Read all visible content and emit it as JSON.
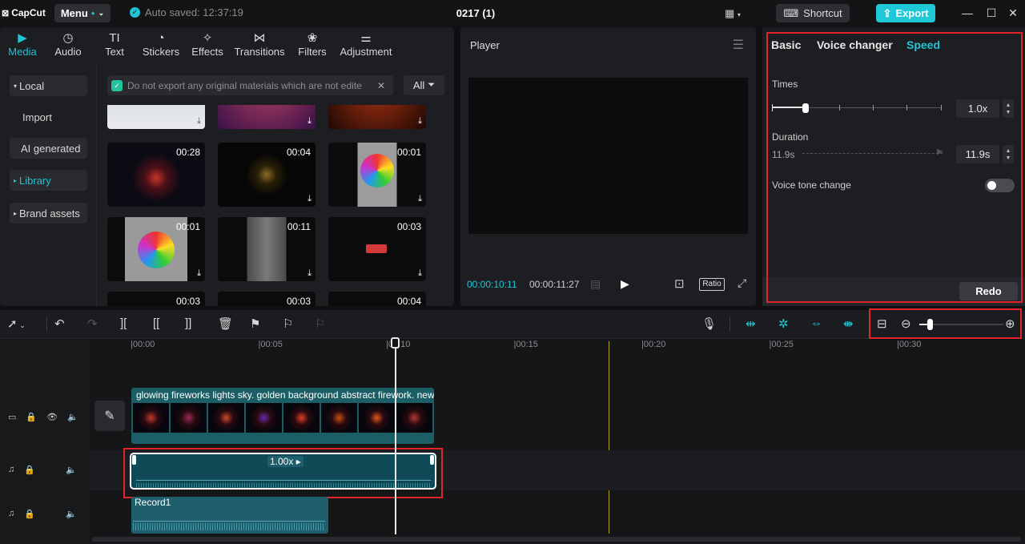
{
  "titlebar": {
    "logo": "CapCut",
    "menu_label": "Menu",
    "autosave": "Auto saved: 12:37:19",
    "project_title": "0217 (1)",
    "shortcut_label": "Shortcut",
    "export_label": "Export"
  },
  "media": {
    "tabs": [
      {
        "label": "Media",
        "icon": "media-icon"
      },
      {
        "label": "Audio",
        "icon": "audio-icon"
      },
      {
        "label": "Text",
        "icon": "text-icon"
      },
      {
        "label": "Stickers",
        "icon": "stickers-icon"
      },
      {
        "label": "Effects",
        "icon": "effects-icon"
      },
      {
        "label": "Transitions",
        "icon": "transitions-icon"
      },
      {
        "label": "Filters",
        "icon": "filters-icon"
      },
      {
        "label": "Adjustment",
        "icon": "adjustment-icon"
      }
    ],
    "sidebar": [
      "Local",
      "Import",
      "AI generated",
      "Library",
      "Brand assets"
    ],
    "notice": "Do not export any original materials which are not edite",
    "filter_label": "All",
    "tiles": [
      {
        "duration": ""
      },
      {
        "duration": ""
      },
      {
        "duration": ""
      },
      {
        "duration": "00:28"
      },
      {
        "duration": "00:04"
      },
      {
        "duration": "00:01"
      },
      {
        "duration": "00:01"
      },
      {
        "duration": "00:11"
      },
      {
        "duration": "00:03"
      },
      {
        "duration": "00:03"
      },
      {
        "duration": "00:03"
      },
      {
        "duration": "00:04"
      }
    ]
  },
  "player": {
    "title": "Player",
    "current_time": "00:00:10:11",
    "total_time": "00:00:11:27",
    "ratio_label": "Ratio"
  },
  "speed_panel": {
    "tabs": [
      "Basic",
      "Voice changer",
      "Speed"
    ],
    "times_label": "Times",
    "times_value": "1.0x",
    "duration_label": "Duration",
    "duration_original": "11.9s",
    "duration_value": "11.9s",
    "voice_tone_label": "Voice tone change",
    "redo_label": "Redo"
  },
  "timeline": {
    "ruler": [
      "|00:00",
      "|00:05",
      "|00:10",
      "|00:15",
      "|00:20",
      "|00:25",
      "|00:30"
    ],
    "video_title": "glowing fireworks lights sky. golden background abstract firework. new",
    "speed_tag": "1.00x",
    "record_title": "Record1"
  },
  "colors": {
    "accent": "#22c4d3",
    "highlight": "#e2242c"
  }
}
